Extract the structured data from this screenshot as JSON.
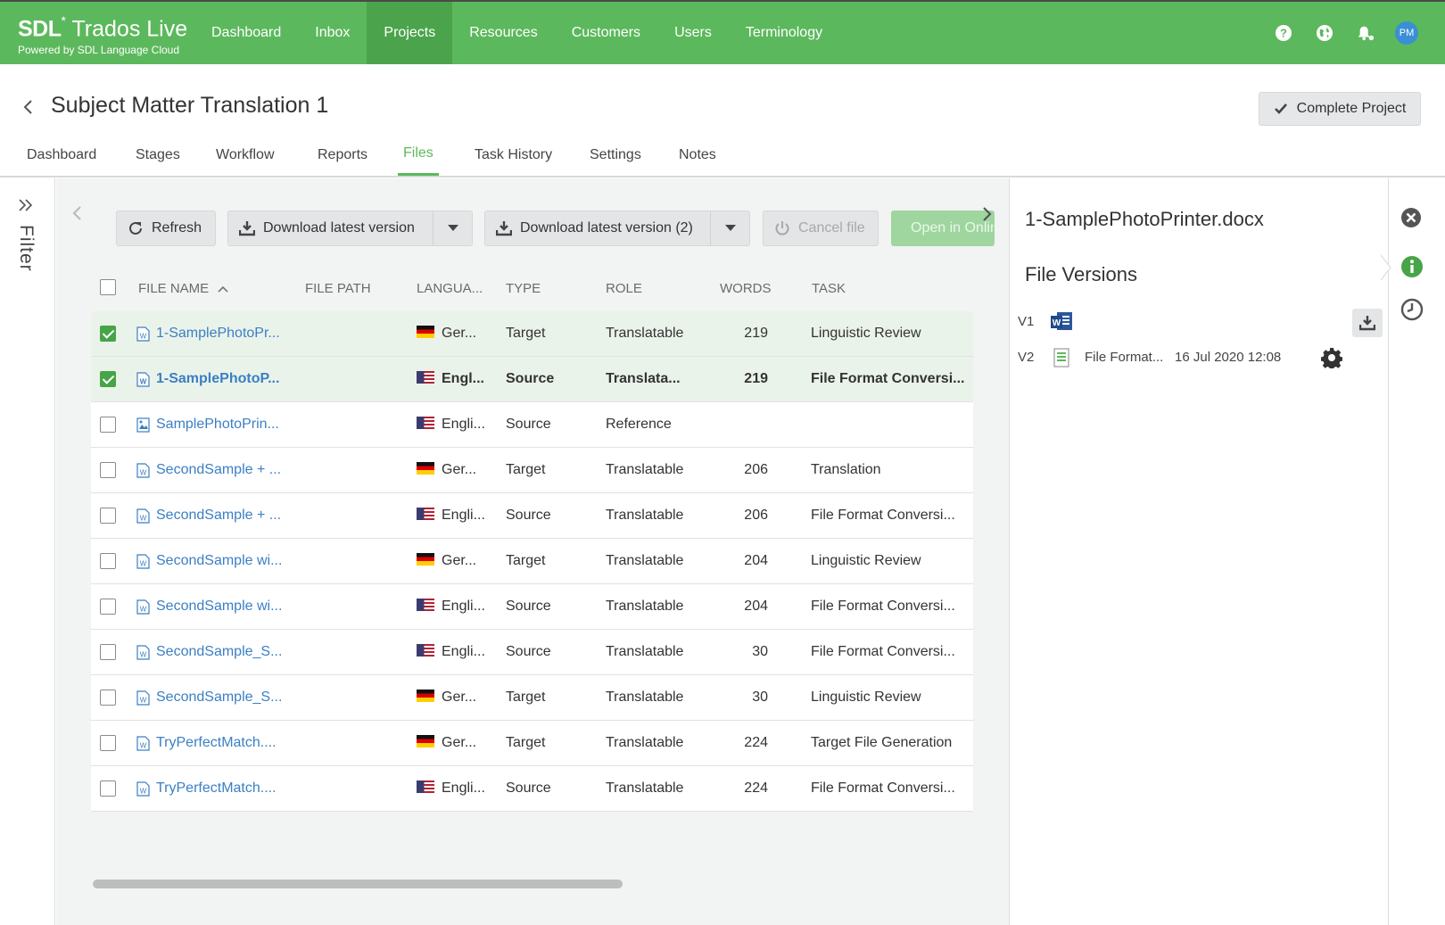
{
  "brand": {
    "name_bold": "SDL",
    "name_star": "*",
    "name_rest": " Trados Live",
    "tagline": "Powered by SDL Language Cloud"
  },
  "nav": {
    "items": [
      {
        "label": "Dashboard"
      },
      {
        "label": "Inbox"
      },
      {
        "label": "Projects"
      },
      {
        "label": "Resources"
      },
      {
        "label": "Customers"
      },
      {
        "label": "Users"
      },
      {
        "label": "Terminology"
      }
    ],
    "active": "Projects",
    "user_initials": "PM"
  },
  "header": {
    "title": "Subject Matter Translation 1",
    "complete_label": "Complete Project"
  },
  "tabs": [
    {
      "label": "Dashboard"
    },
    {
      "label": "Stages"
    },
    {
      "label": "Workflow"
    },
    {
      "label": "Reports"
    },
    {
      "label": "Files"
    },
    {
      "label": "Task History"
    },
    {
      "label": "Settings"
    },
    {
      "label": "Notes"
    }
  ],
  "active_tab": "Files",
  "filter": {
    "label": "Filter"
  },
  "toolbar": {
    "refresh": "Refresh",
    "download_latest": "Download latest version",
    "download_latest_multi": "Download latest version (2)",
    "cancel_file": "Cancel file",
    "open_in": "Open in Online Editor"
  },
  "table": {
    "columns": [
      "FILE NAME",
      "FILE PATH",
      "LANGUA...",
      "TYPE",
      "ROLE",
      "WORDS",
      "TASK"
    ],
    "rows": [
      {
        "name": "1-SamplePhotoPr...",
        "path": "",
        "lang": "Ger...",
        "flag": "de",
        "type": "Target",
        "role": "Translatable",
        "words": "219",
        "task": "Linguistic Review",
        "checked": true,
        "bold": false,
        "icon": "word"
      },
      {
        "name": "1-SamplePhotoP...",
        "path": "",
        "lang": "Engl...",
        "flag": "us",
        "type": "Source",
        "role": "Translata...",
        "words": "219",
        "task": "File Format Conversi...",
        "checked": true,
        "bold": true,
        "icon": "word"
      },
      {
        "name": "SamplePhotoPrin...",
        "path": "",
        "lang": "Engli...",
        "flag": "us",
        "type": "Source",
        "role": "Reference",
        "words": "",
        "task": "",
        "checked": false,
        "bold": false,
        "icon": "image"
      },
      {
        "name": "SecondSample + ...",
        "path": "",
        "lang": "Ger...",
        "flag": "de",
        "type": "Target",
        "role": "Translatable",
        "words": "206",
        "task": "Translation",
        "checked": false,
        "bold": false,
        "icon": "word"
      },
      {
        "name": "SecondSample + ...",
        "path": "",
        "lang": "Engli...",
        "flag": "us",
        "type": "Source",
        "role": "Translatable",
        "words": "206",
        "task": "File Format Conversi...",
        "checked": false,
        "bold": false,
        "icon": "word"
      },
      {
        "name": "SecondSample wi...",
        "path": "",
        "lang": "Ger...",
        "flag": "de",
        "type": "Target",
        "role": "Translatable",
        "words": "204",
        "task": "Linguistic Review",
        "checked": false,
        "bold": false,
        "icon": "word"
      },
      {
        "name": "SecondSample wi...",
        "path": "",
        "lang": "Engli...",
        "flag": "us",
        "type": "Source",
        "role": "Translatable",
        "words": "204",
        "task": "File Format Conversi...",
        "checked": false,
        "bold": false,
        "icon": "word"
      },
      {
        "name": "SecondSample_S...",
        "path": "",
        "lang": "Engli...",
        "flag": "us",
        "type": "Source",
        "role": "Translatable",
        "words": "30",
        "task": "File Format Conversi...",
        "checked": false,
        "bold": false,
        "icon": "word"
      },
      {
        "name": "SecondSample_S...",
        "path": "",
        "lang": "Ger...",
        "flag": "de",
        "type": "Target",
        "role": "Translatable",
        "words": "30",
        "task": "Linguistic Review",
        "checked": false,
        "bold": false,
        "icon": "word"
      },
      {
        "name": "TryPerfectMatch....",
        "path": "",
        "lang": "Ger...",
        "flag": "de",
        "type": "Target",
        "role": "Translatable",
        "words": "224",
        "task": "Target File Generation",
        "checked": false,
        "bold": false,
        "icon": "word"
      },
      {
        "name": "TryPerfectMatch....",
        "path": "",
        "lang": "Engli...",
        "flag": "us",
        "type": "Source",
        "role": "Translatable",
        "words": "224",
        "task": "File Format Conversi...",
        "checked": false,
        "bold": false,
        "icon": "word"
      }
    ]
  },
  "panel": {
    "file_title": "1-SamplePhotoPrinter.docx",
    "section": "File Versions",
    "versions": [
      {
        "label": "V1",
        "icon": "word-icon",
        "name": "",
        "date": ""
      },
      {
        "label": "V2",
        "icon": "document-icon",
        "name": "File Format...",
        "date": "16 Jul 2020 12:08"
      }
    ]
  },
  "colors": {
    "brand_green": "#5cb85c",
    "link_blue": "#3b7fc4",
    "selected_row": "#eaf3ea"
  }
}
